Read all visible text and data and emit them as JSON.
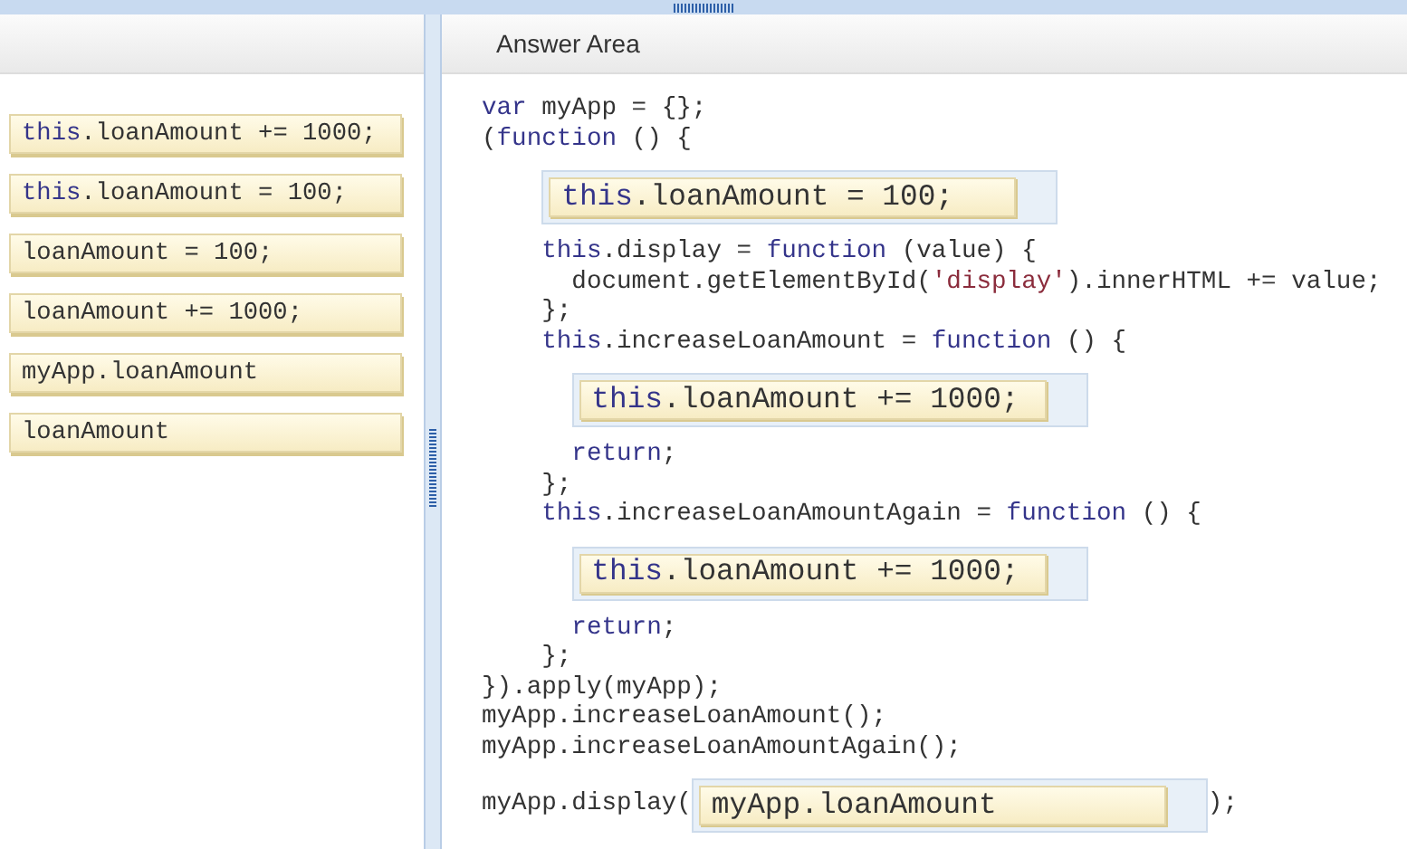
{
  "options_panel": {
    "options": [
      {
        "segments": [
          {
            "kind": "keyword",
            "text": "this"
          },
          {
            "kind": "plain",
            "text": ".loanAmount += 1000;"
          }
        ]
      },
      {
        "segments": [
          {
            "kind": "keyword",
            "text": "this"
          },
          {
            "kind": "plain",
            "text": ".loanAmount = 100;"
          }
        ]
      },
      {
        "segments": [
          {
            "kind": "plain",
            "text": "loanAmount = 100;"
          }
        ]
      },
      {
        "segments": [
          {
            "kind": "plain",
            "text": "loanAmount += 1000;"
          }
        ]
      },
      {
        "segments": [
          {
            "kind": "plain",
            "text": "myApp.loanAmount"
          }
        ]
      },
      {
        "segments": [
          {
            "kind": "plain",
            "text": "loanAmount"
          }
        ]
      }
    ]
  },
  "answer_area": {
    "title": "Answer Area",
    "lines": [
      {
        "kind": "code",
        "segments": [
          {
            "kind": "keyword",
            "text": "var"
          },
          {
            "kind": "plain",
            "text": " myApp = {};"
          }
        ]
      },
      {
        "kind": "code",
        "segments": [
          {
            "kind": "plain",
            "text": "("
          },
          {
            "kind": "keyword",
            "text": "function"
          },
          {
            "kind": "plain",
            "text": " () {"
          }
        ]
      },
      {
        "kind": "slot",
        "segments": [
          {
            "kind": "keyword",
            "text": "this"
          },
          {
            "kind": "plain",
            "text": ".loanAmount = 100;"
          }
        ]
      },
      {
        "kind": "code",
        "segments": [
          {
            "kind": "keyword",
            "text": "    this"
          },
          {
            "kind": "plain",
            "text": ".display = "
          },
          {
            "kind": "keyword",
            "text": "function"
          },
          {
            "kind": "plain",
            "text": " (value) {"
          }
        ]
      },
      {
        "kind": "code",
        "segments": [
          {
            "kind": "plain",
            "text": "      document.getElementById("
          },
          {
            "kind": "string",
            "text": "'display'"
          },
          {
            "kind": "plain",
            "text": ").innerHTML += value;"
          }
        ]
      },
      {
        "kind": "code",
        "segments": [
          {
            "kind": "plain",
            "text": "    };"
          }
        ]
      },
      {
        "kind": "code",
        "segments": [
          {
            "kind": "keyword",
            "text": "    this"
          },
          {
            "kind": "plain",
            "text": ".increaseLoanAmount = "
          },
          {
            "kind": "keyword",
            "text": "function"
          },
          {
            "kind": "plain",
            "text": " () {"
          }
        ]
      },
      {
        "kind": "nested_slot",
        "segments": [
          {
            "kind": "keyword",
            "text": "this"
          },
          {
            "kind": "plain",
            "text": ".loanAmount += 1000;"
          }
        ]
      },
      {
        "kind": "code",
        "segments": [
          {
            "kind": "keyword",
            "text": "      return"
          },
          {
            "kind": "plain",
            "text": ";"
          }
        ]
      },
      {
        "kind": "code",
        "segments": [
          {
            "kind": "plain",
            "text": "    };"
          }
        ]
      },
      {
        "kind": "code",
        "segments": [
          {
            "kind": "keyword",
            "text": "    this"
          },
          {
            "kind": "plain",
            "text": ".increaseLoanAmountAgain = "
          },
          {
            "kind": "keyword",
            "text": "function"
          },
          {
            "kind": "plain",
            "text": " () {"
          }
        ]
      },
      {
        "kind": "nested_slot",
        "segments": [
          {
            "kind": "keyword",
            "text": "this"
          },
          {
            "kind": "plain",
            "text": ".loanAmount += 1000;"
          }
        ]
      },
      {
        "kind": "code",
        "segments": [
          {
            "kind": "keyword",
            "text": "      return"
          },
          {
            "kind": "plain",
            "text": ";"
          }
        ]
      },
      {
        "kind": "code",
        "segments": [
          {
            "kind": "plain",
            "text": "    };"
          }
        ]
      },
      {
        "kind": "code",
        "segments": [
          {
            "kind": "plain",
            "text": "}).apply(myApp);"
          }
        ]
      },
      {
        "kind": "code",
        "segments": [
          {
            "kind": "plain",
            "text": "myApp.increaseLoanAmount();"
          }
        ]
      },
      {
        "kind": "code",
        "segments": [
          {
            "kind": "plain",
            "text": "myApp.increaseLoanAmountAgain();"
          }
        ]
      },
      {
        "kind": "inline_slot",
        "before": "myApp.display(",
        "segments": [
          {
            "kind": "plain",
            "text": "myApp.loanAmount"
          }
        ],
        "after": ");"
      }
    ]
  }
}
